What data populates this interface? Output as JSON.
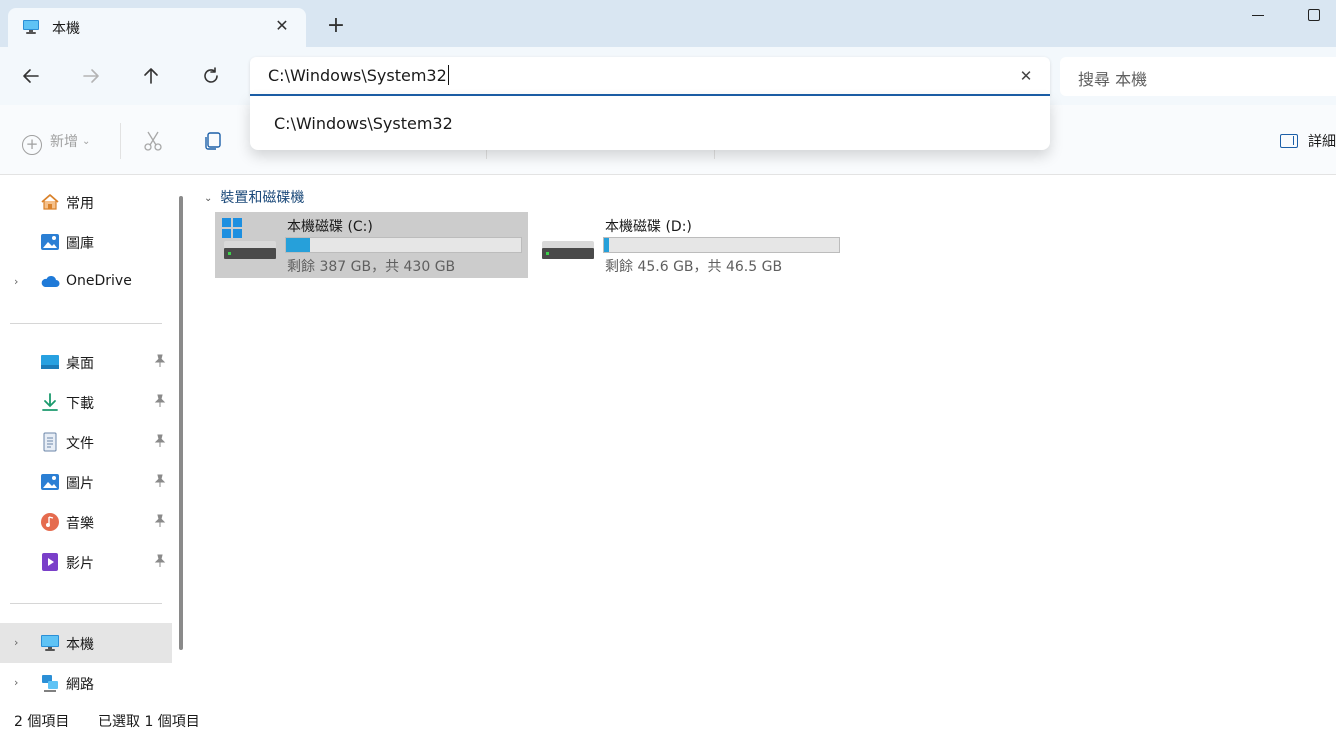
{
  "window": {
    "tab_title": "本機",
    "tab_icon": "monitor-icon",
    "new_tab_label": "+",
    "close_glyph": "✕"
  },
  "nav": {
    "address_value": "C:\\Windows\\System32",
    "address_clear_glyph": "✕",
    "search_placeholder": "搜尋 本機",
    "suggestion": "C:\\Windows\\System32"
  },
  "command_bar": {
    "new_label": "新增",
    "details_label": "詳細"
  },
  "sidebar": {
    "quick": [
      {
        "label": "常用",
        "icon": "home-icon"
      },
      {
        "label": "圖庫",
        "icon": "gallery-icon"
      },
      {
        "label": "OneDrive",
        "icon": "cloud-icon"
      }
    ],
    "pinned": [
      {
        "label": "桌面",
        "icon": "desktop-icon"
      },
      {
        "label": "下載",
        "icon": "download-icon"
      },
      {
        "label": "文件",
        "icon": "document-icon"
      },
      {
        "label": "圖片",
        "icon": "pictures-icon"
      },
      {
        "label": "音樂",
        "icon": "music-icon"
      },
      {
        "label": "影片",
        "icon": "video-icon"
      }
    ],
    "locations": [
      {
        "label": "本機",
        "icon": "monitor-icon",
        "selected": true
      },
      {
        "label": "網路",
        "icon": "network-icon",
        "selected": false
      }
    ]
  },
  "content": {
    "group_title": "裝置和磁碟機",
    "drives": [
      {
        "name": "本機磁碟 (C:)",
        "free_text": "剩餘 387 GB，共 430 GB",
        "used_fraction": 0.1,
        "selected": true
      },
      {
        "name": "本機磁碟 (D:)",
        "free_text": "剩餘 45.6 GB，共 46.5 GB",
        "used_fraction": 0.02,
        "selected": false
      }
    ]
  },
  "status": {
    "item_count": "2 個項目",
    "selected_count": "已選取 1 個項目"
  },
  "colors": {
    "accent": "#1c5fa8",
    "titlebar": "#d9e6f2",
    "toolbar": "#f3f8fc",
    "usage_bar": "#26a0da",
    "selection": "#cccccc"
  }
}
